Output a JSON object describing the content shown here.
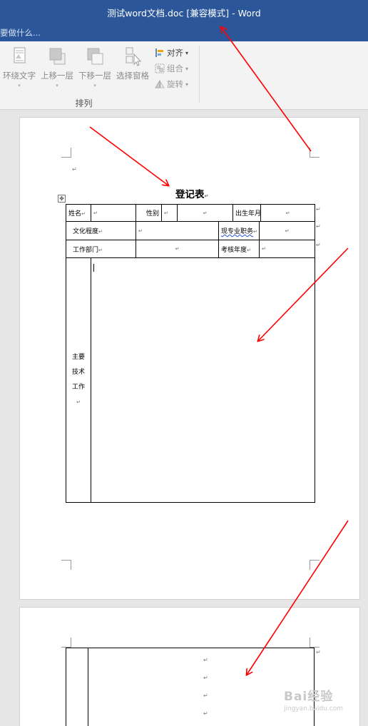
{
  "window": {
    "title": "测试word文档.doc [兼容模式] - Word"
  },
  "tell_me": {
    "placeholder": "要做什么..."
  },
  "ribbon": {
    "buttons": [
      {
        "label": "环绕文字",
        "icon": "wrap-text-icon"
      },
      {
        "label": "上移一层",
        "icon": "bring-forward-icon"
      },
      {
        "label": "下移一层",
        "icon": "send-backward-icon"
      },
      {
        "label": "选择窗格",
        "icon": "selection-pane-icon"
      }
    ],
    "align_label": "对齐",
    "group_label": "组合",
    "rotate_label": "旋转",
    "arrange_group": "排列",
    "align_caret": "▾",
    "group_caret": "▾",
    "rotate_caret": "▾",
    "caret": "▾"
  },
  "document": {
    "title": "登记表",
    "table": {
      "name_label": "姓名",
      "gender_label": "性别",
      "birth_label": "出生年月",
      "education_label": "文化程度",
      "position_label": "现专业职务",
      "department_label": "工作部门",
      "review_year_label": "考核年度",
      "main_work_label": [
        "主要",
        "技术",
        "工作"
      ]
    }
  },
  "colors": {
    "title_bar": "#2b579a",
    "ribbon": "#f3f3f3",
    "annotation_arrow": "#ff0000"
  },
  "watermark": {
    "text": "Bai经验",
    "url": "jingyan.baidu.com"
  }
}
